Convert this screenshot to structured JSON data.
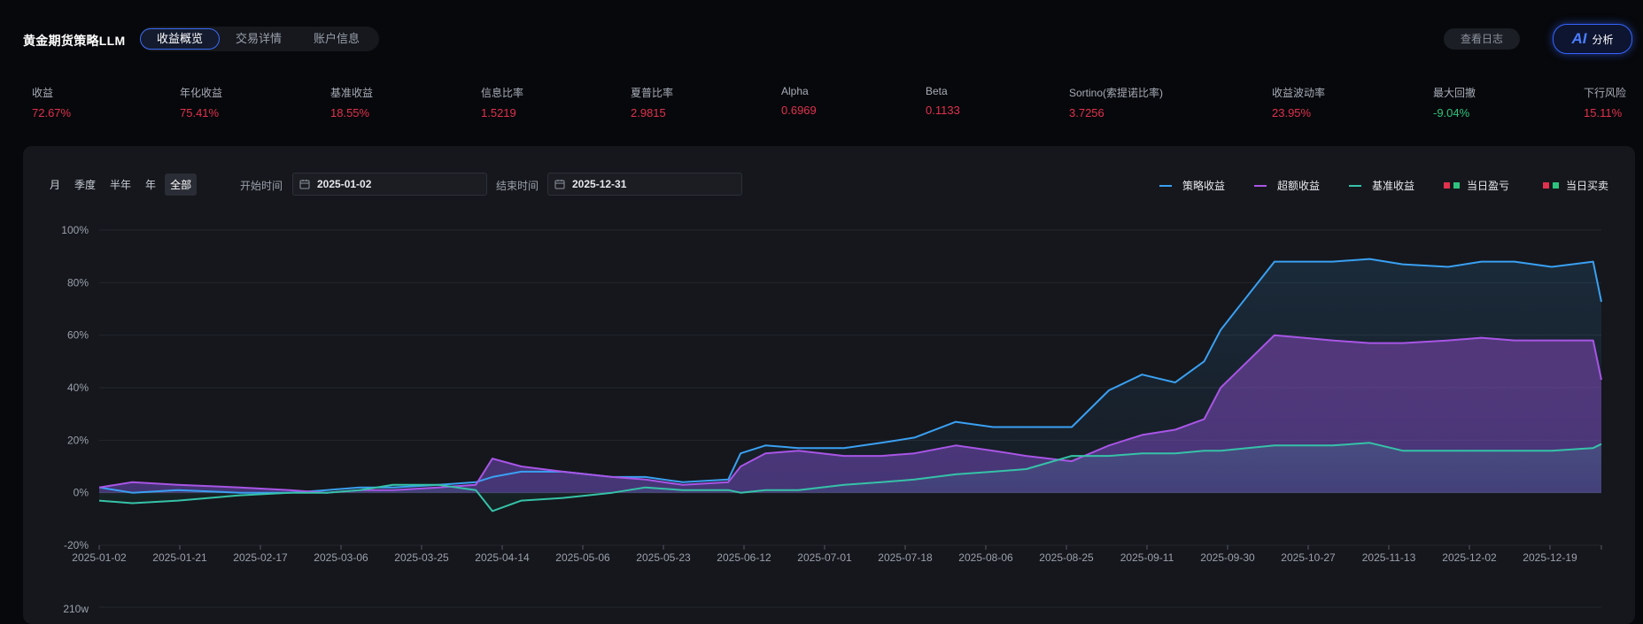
{
  "app": {
    "title": "黄金期货策略LLM"
  },
  "tabs": [
    {
      "label": "收益概览",
      "active": true
    },
    {
      "label": "交易详情",
      "active": false
    },
    {
      "label": "账户信息",
      "active": false
    }
  ],
  "actions": {
    "log": "查看日志",
    "ai_logo": "AI",
    "ai_label": "分析"
  },
  "metrics": [
    {
      "label": "收益",
      "value": "72.67%",
      "color": "#e0314e"
    },
    {
      "label": "年化收益",
      "value": "75.41%",
      "color": "#e0314e"
    },
    {
      "label": "基准收益",
      "value": "18.55%",
      "color": "#e0314e"
    },
    {
      "label": "信息比率",
      "value": "1.5219",
      "color": "#e0314e"
    },
    {
      "label": "夏普比率",
      "value": "2.9815",
      "color": "#e0314e"
    },
    {
      "label": "Alpha",
      "value": "0.6969",
      "color": "#e0314e"
    },
    {
      "label": "Beta",
      "value": "0.1133",
      "color": "#e0314e"
    },
    {
      "label": "Sortino(索提诺比率)",
      "value": "3.7256",
      "color": "#e0314e"
    },
    {
      "label": "收益波动率",
      "value": "23.95%",
      "color": "#e0314e"
    },
    {
      "label": "最大回撤",
      "value": "-9.04%",
      "color": "#2ec27e"
    },
    {
      "label": "下行风险",
      "value": "15.11%",
      "color": "#e0314e"
    }
  ],
  "filters": {
    "periods": [
      {
        "label": "月",
        "active": false
      },
      {
        "label": "季度",
        "active": false
      },
      {
        "label": "半年",
        "active": false
      },
      {
        "label": "年",
        "active": false
      },
      {
        "label": "全部",
        "active": true
      }
    ],
    "start_label": "开始时间",
    "start_value": "2025-01-02",
    "end_label": "结束时间",
    "end_value": "2025-12-31"
  },
  "legend": [
    {
      "label": "策略收益",
      "type": "line",
      "color": "#3aa0f2"
    },
    {
      "label": "超额收益",
      "type": "line",
      "color": "#a855e6"
    },
    {
      "label": "基准收益",
      "type": "line",
      "color": "#36c2a8"
    },
    {
      "label": "当日盈亏",
      "type": "squares",
      "colors": [
        "#e0314e",
        "#2ec27e"
      ]
    },
    {
      "label": "当日买卖",
      "type": "squares",
      "colors": [
        "#e0314e",
        "#2ec27e"
      ]
    }
  ],
  "chart_data": {
    "type": "line",
    "ylim": [
      -20,
      100
    ],
    "yticks": [
      "100%",
      "80%",
      "60%",
      "40%",
      "20%",
      "0%",
      "-20%"
    ],
    "ytick_values": [
      100,
      80,
      60,
      40,
      20,
      0,
      -20
    ],
    "xtick_labels": [
      "2025-01-02",
      "2025-01-21",
      "2025-02-17",
      "2025-03-06",
      "2025-03-25",
      "2025-04-14",
      "2025-05-06",
      "2025-05-23",
      "2025-06-12",
      "2025-07-01",
      "2025-07-18",
      "2025-08-06",
      "2025-08-25",
      "2025-09-11",
      "2025-09-30",
      "2025-10-27",
      "2025-11-13",
      "2025-12-02",
      "2025-12-19"
    ],
    "x": [
      "2025-01-02",
      "2025-01-10",
      "2025-01-21",
      "2025-02-05",
      "2025-02-17",
      "2025-02-26",
      "2025-03-06",
      "2025-03-14",
      "2025-03-25",
      "2025-04-03",
      "2025-04-07",
      "2025-04-14",
      "2025-04-24",
      "2025-05-06",
      "2025-05-14",
      "2025-05-23",
      "2025-06-03",
      "2025-06-06",
      "2025-06-12",
      "2025-06-20",
      "2025-07-01",
      "2025-07-10",
      "2025-07-18",
      "2025-07-28",
      "2025-08-06",
      "2025-08-14",
      "2025-08-25",
      "2025-09-03",
      "2025-09-11",
      "2025-09-19",
      "2025-09-26",
      "2025-09-30",
      "2025-10-13",
      "2025-10-20",
      "2025-10-27",
      "2025-11-05",
      "2025-11-13",
      "2025-11-24",
      "2025-12-02",
      "2025-12-10",
      "2025-12-19",
      "2025-12-29",
      "2025-12-31"
    ],
    "series": [
      {
        "name": "策略收益",
        "color": "#3aa0f2",
        "values": [
          2,
          0,
          1,
          0,
          0,
          1,
          2,
          2,
          3,
          4,
          6,
          8,
          8,
          6,
          6,
          4,
          5,
          15,
          18,
          17,
          17,
          19,
          21,
          27,
          25,
          25,
          25,
          39,
          45,
          42,
          50,
          62,
          88,
          88,
          88,
          89,
          87,
          86,
          88,
          88,
          86,
          88,
          72.7
        ]
      },
      {
        "name": "超额收益",
        "color": "#a855e6",
        "values": [
          2,
          4,
          3,
          2,
          1,
          0,
          1,
          1,
          2,
          3,
          13,
          10,
          8,
          6,
          5,
          3,
          4,
          10,
          15,
          16,
          14,
          14,
          15,
          18,
          16,
          14,
          12,
          18,
          22,
          24,
          28,
          40,
          60,
          59,
          58,
          57,
          57,
          58,
          59,
          58,
          58,
          58,
          43
        ]
      },
      {
        "name": "基准收益",
        "color": "#36c2a8",
        "values": [
          -3,
          -4,
          -3,
          -1,
          0,
          0,
          1,
          3,
          3,
          1,
          -7,
          -3,
          -2,
          0,
          2,
          1,
          1,
          0,
          1,
          1,
          3,
          4,
          5,
          7,
          8,
          9,
          14,
          14,
          15,
          15,
          16,
          16,
          18,
          18,
          18,
          19,
          16,
          16,
          16,
          16,
          16,
          17,
          18.55
        ]
      }
    ],
    "next_axis_tick": "210w"
  }
}
